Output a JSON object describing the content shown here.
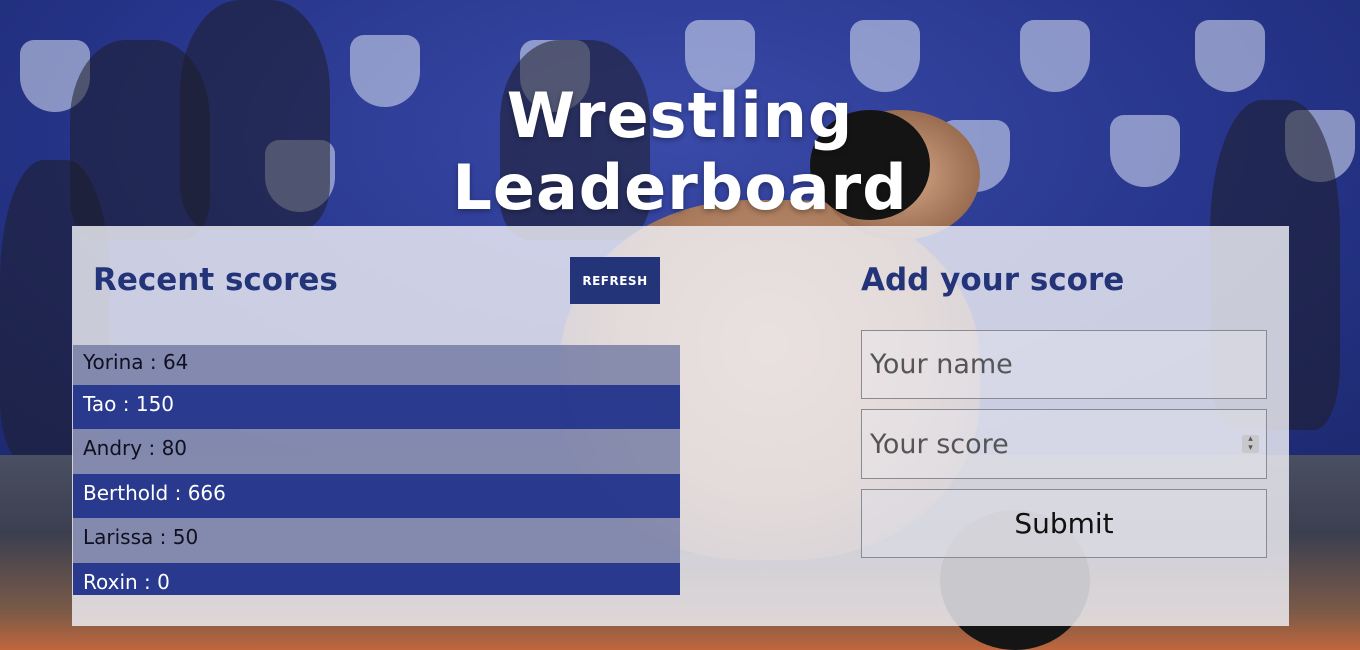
{
  "page": {
    "title": "Wrestling Leaderboard"
  },
  "recent_scores": {
    "heading": "Recent scores",
    "refresh_label": "REFRESH",
    "entries": [
      "Yorina : 64",
      "Tao : 150",
      "Andry : 80",
      "Berthold : 666",
      "Larissa : 50",
      "Roxin : 0"
    ]
  },
  "add_score": {
    "heading": "Add your score",
    "name_placeholder": "Your name",
    "score_placeholder": "Your score",
    "submit_label": "Submit"
  },
  "colors": {
    "accent": "#243478",
    "row_dark": "#20328a",
    "row_light": "#6e76a0"
  }
}
